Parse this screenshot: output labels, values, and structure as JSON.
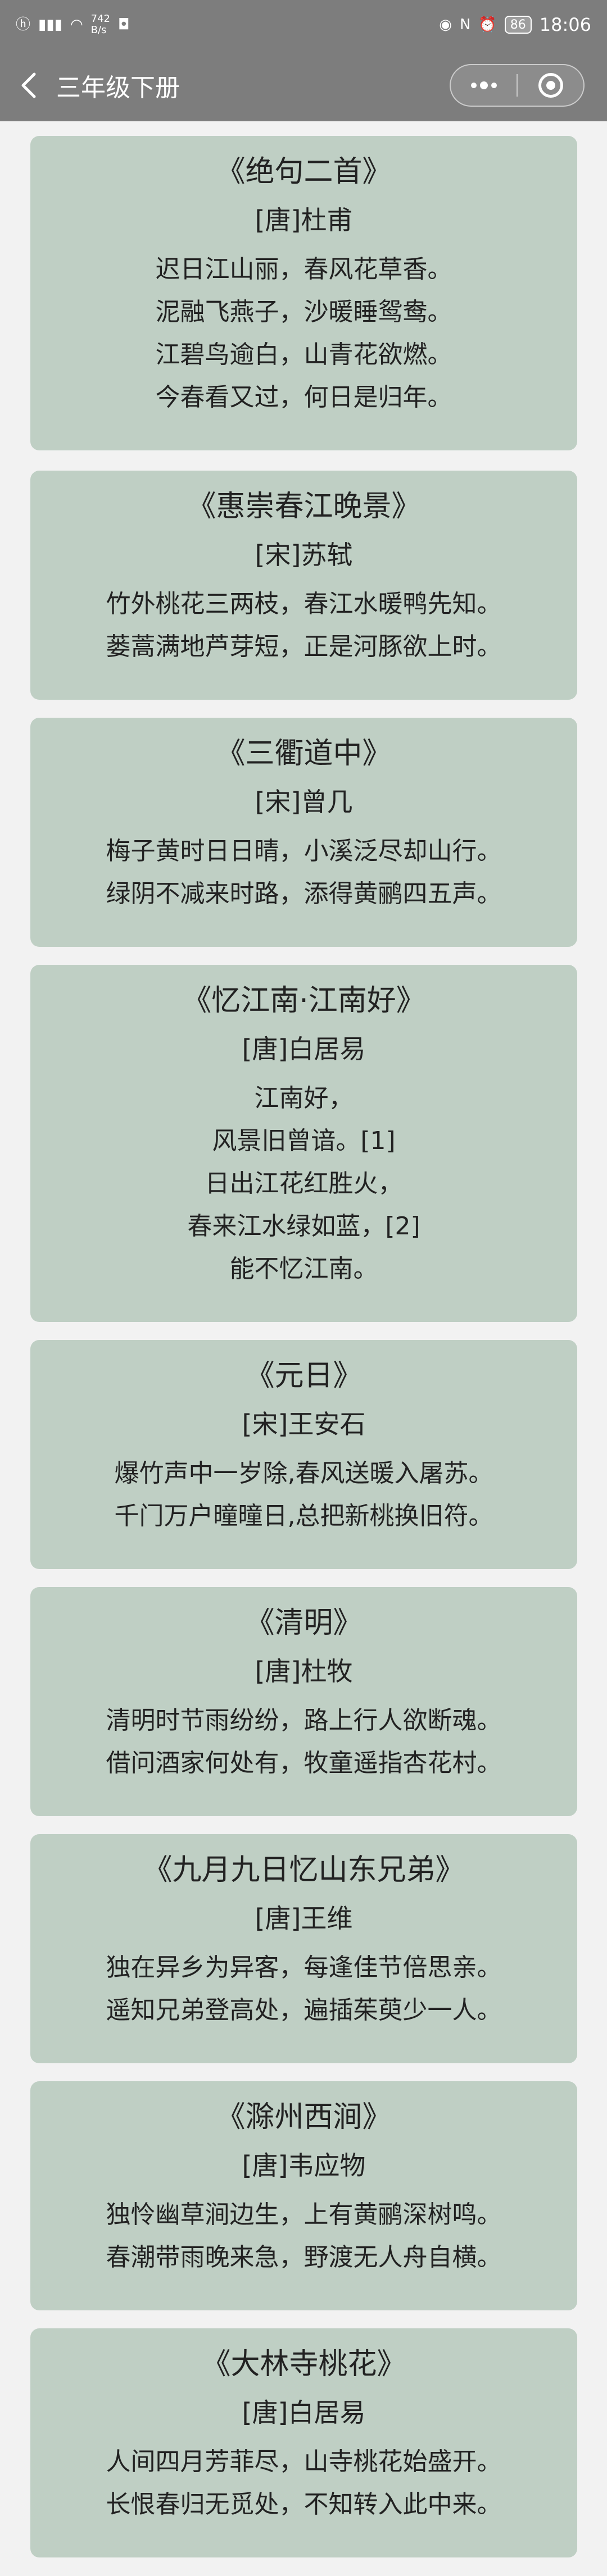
{
  "status_bar": {
    "left_icons": [
      "hd-icon",
      "signal-icon",
      "wifi-icon"
    ],
    "speed_value": "742",
    "speed_unit": "B/s",
    "battery": "86",
    "time": "18:06"
  },
  "nav": {
    "title": "三年级下册"
  },
  "poems": [
    {
      "title": "《绝句二首》",
      "author": "[唐]杜甫",
      "lines": [
        "迟日江山丽，春风花草香。",
        "泥融飞燕子，沙暖睡鸳鸯。",
        "江碧鸟逾白，山青花欲燃。",
        "今春看又过，何日是归年。"
      ]
    },
    {
      "title": "《惠崇春江晚景》",
      "author": "[宋]苏轼",
      "lines": [
        "竹外桃花三两枝，春江水暖鸭先知。",
        "蒌蒿满地芦芽短，正是河豚欲上时。"
      ]
    },
    {
      "title": "《三衢道中》",
      "author": "[宋]曾几",
      "lines": [
        "梅子黄时日日晴，小溪泛尽却山行。",
        "绿阴不减来时路，添得黄鹂四五声。"
      ]
    },
    {
      "title": "《忆江南·江南好》",
      "author": "[唐]白居易",
      "lines": [
        "江南好，",
        "风景旧曾谙。[1]",
        "日出江花红胜火，",
        "春来江水绿如蓝，[2]",
        "能不忆江南。"
      ]
    },
    {
      "title": "《元日》",
      "author": "[宋]王安石",
      "lines": [
        "爆竹声中一岁除,春风送暖入屠苏。",
        "千门万户曈曈日,总把新桃换旧符。"
      ]
    },
    {
      "title": "《清明》",
      "author": "[唐]杜牧",
      "lines": [
        "清明时节雨纷纷，路上行人欲断魂。",
        "借问酒家何处有，牧童遥指杏花村。"
      ]
    },
    {
      "title": "《九月九日忆山东兄弟》",
      "author": "[唐]王维",
      "lines": [
        "独在异乡为异客，每逢佳节倍思亲。",
        "遥知兄弟登高处，遍插茱萸少一人。"
      ]
    },
    {
      "title": "《滁州西涧》",
      "author": "[唐]韦应物",
      "lines": [
        "独怜幽草涧边生，上有黄鹂深树鸣。",
        "春潮带雨晚来急，野渡无人舟自横。"
      ]
    },
    {
      "title": "《大林寺桃花》",
      "author": "[唐]白居易",
      "lines": [
        "人间四月芳菲尽，山寺桃花始盛开。",
        "长恨春归无觅处，不知转入此中来。"
      ]
    }
  ],
  "colors": {
    "bar": "#7d7d7d",
    "card": "#bfcfc4",
    "page": "#f2f2f2"
  }
}
